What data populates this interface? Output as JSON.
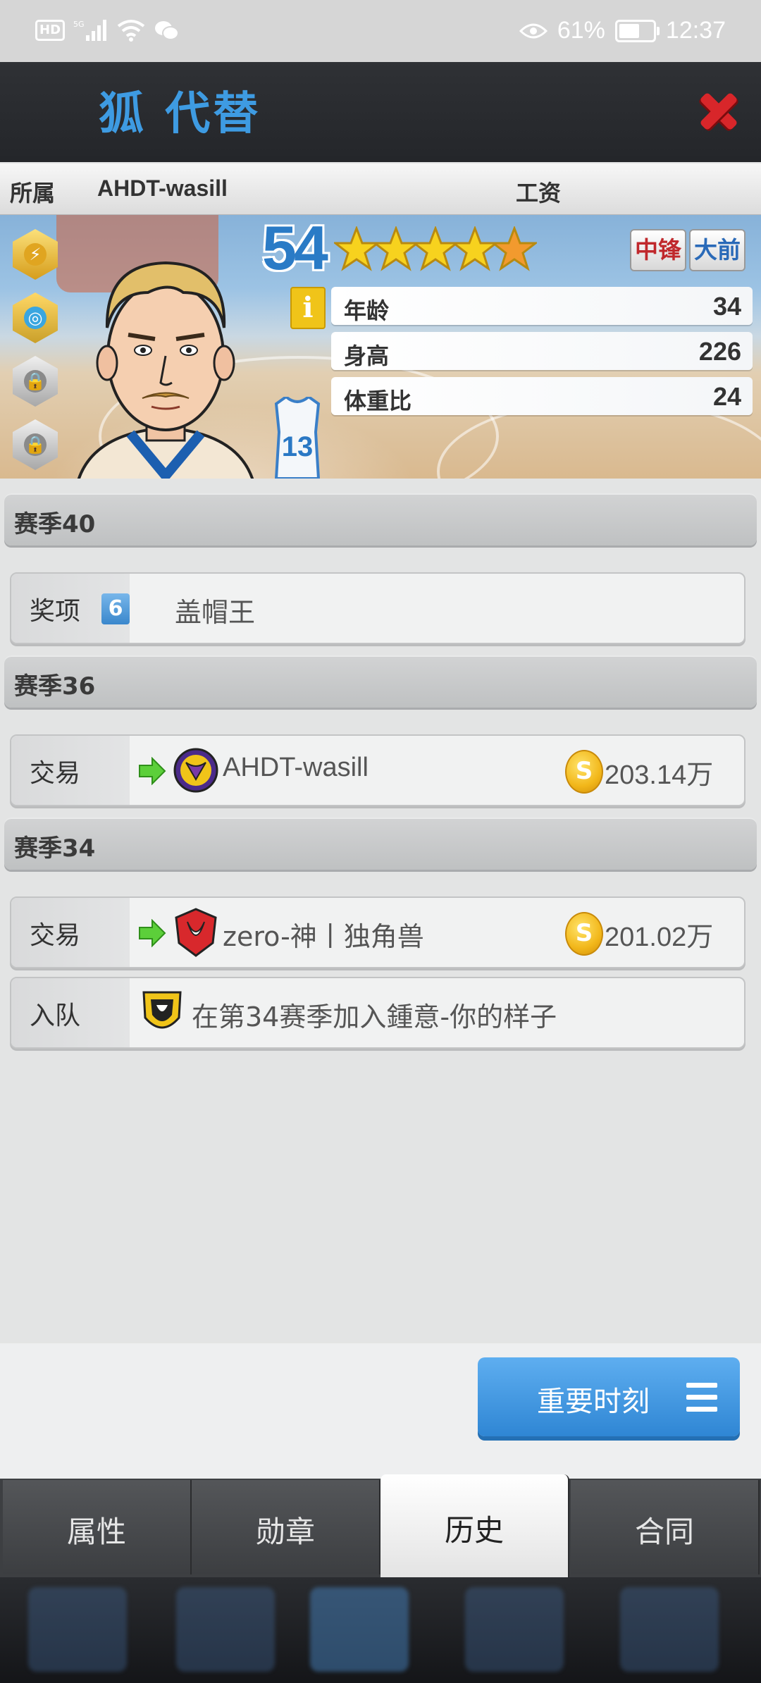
{
  "status_bar": {
    "left_icons": [
      "hd-icon",
      "5g-signal-icon",
      "wifi-icon",
      "wechat-icon"
    ],
    "hd_label": "HD",
    "battery_percent": "61%",
    "battery_level": 0.61,
    "time": "12:37"
  },
  "header": {
    "title": "狐 代替"
  },
  "player": {
    "team_label": "所属",
    "team_name": "AHDT-wasill",
    "salary_label": "工资",
    "overall": "54",
    "stars": 4.5,
    "positions": [
      "中锋",
      "大前"
    ],
    "jersey_number": "13",
    "stats": [
      {
        "label": "年龄",
        "value": "34"
      },
      {
        "label": "身高",
        "value": "226"
      },
      {
        "label": "体重比",
        "value": "24"
      }
    ]
  },
  "history": {
    "seasons": [
      {
        "title": "赛季40",
        "entries": [
          {
            "type": "奖项",
            "badge": "6",
            "text": "盖帽王"
          }
        ]
      },
      {
        "title": "赛季36",
        "entries": [
          {
            "type": "交易",
            "team": "AHDT-wasill",
            "amount": "203.14万"
          }
        ]
      },
      {
        "title": "赛季34",
        "entries": [
          {
            "type": "交易",
            "team": "zero-神丨独角兽",
            "amount": "201.02万"
          },
          {
            "type": "入队",
            "text": "在第34赛季加入鍾意-你的样子"
          }
        ]
      }
    ]
  },
  "actions": {
    "moments_label": "重要时刻"
  },
  "tabs": [
    {
      "label": "属性",
      "active": false
    },
    {
      "label": "勋章",
      "active": false
    },
    {
      "label": "历史",
      "active": true
    },
    {
      "label": "合同",
      "active": false
    }
  ],
  "colors": {
    "title": "#3e9be2",
    "close": "#d8262a",
    "center_badge": "#c0282c",
    "forward_badge": "#2a6ab8",
    "moments_button": "#3a8fd8"
  }
}
